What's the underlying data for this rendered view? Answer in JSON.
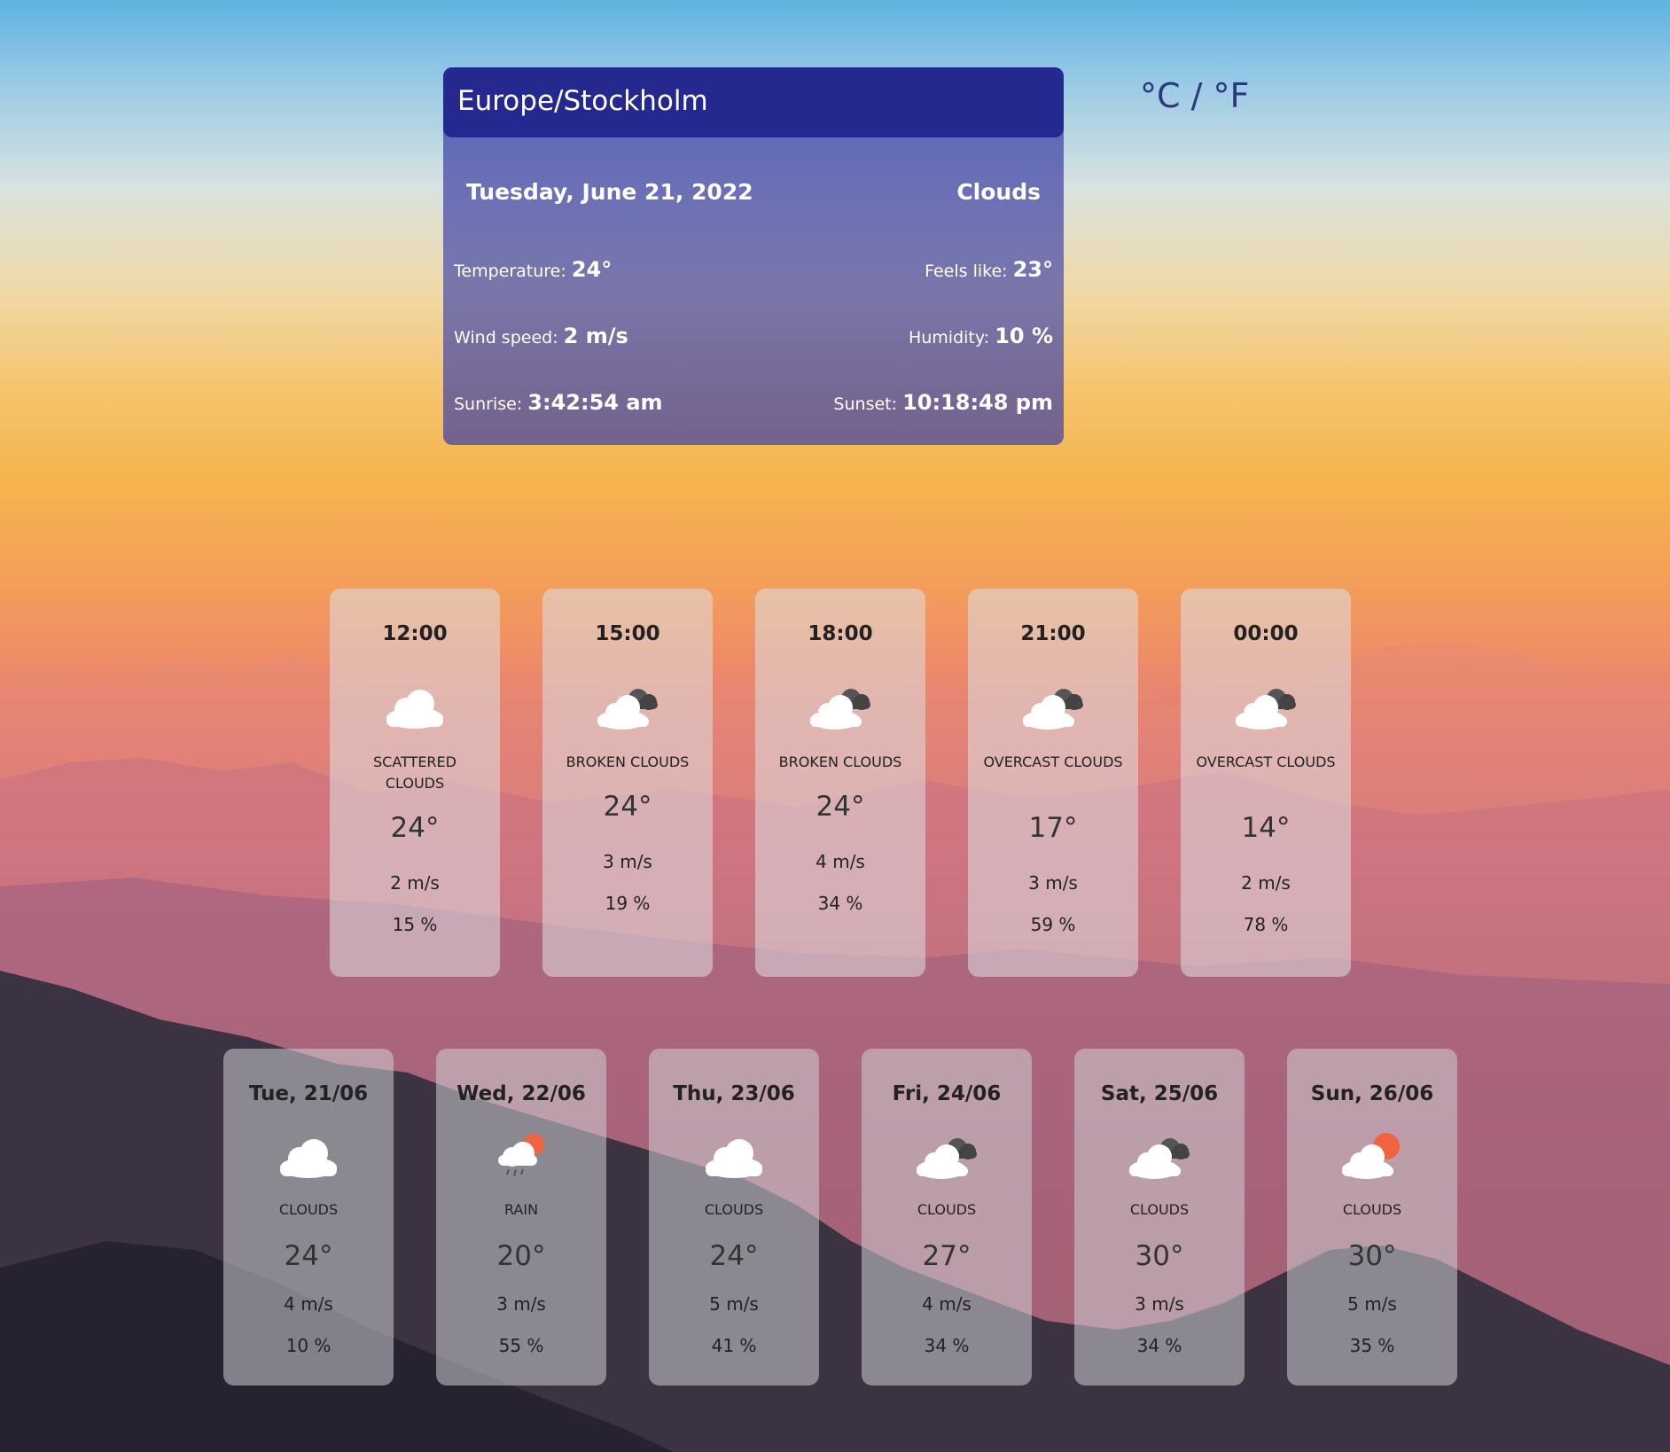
{
  "main": {
    "city": "Europe/Stockholm",
    "date": "Tuesday, June 21, 2022",
    "condition": "Clouds",
    "temperature_label": "Temperature:",
    "temperature_value": "24°",
    "feels_like_label": "Feels like:",
    "feels_like_value": "23°",
    "wind_label": "Wind speed:",
    "wind_value": "2 m/s",
    "humidity_label": "Humidity:",
    "humidity_value": "10 %",
    "sunrise_label": "Sunrise:",
    "sunrise_value": "3:42:54 am",
    "sunset_label": "Sunset:",
    "sunset_value": "10:18:48 pm"
  },
  "unit_toggle": "°C / °F",
  "hourly": [
    {
      "time": "12:00",
      "icon": "cloud-icon",
      "desc": "SCATTERED CLOUDS",
      "temp": "24°",
      "wind": "2 m/s",
      "humidity": "15 %"
    },
    {
      "time": "15:00",
      "icon": "broken-clouds-icon",
      "desc": "BROKEN CLOUDS",
      "temp": "24°",
      "wind": "3 m/s",
      "humidity": "19 %"
    },
    {
      "time": "18:00",
      "icon": "broken-clouds-icon",
      "desc": "BROKEN CLOUDS",
      "temp": "24°",
      "wind": "4 m/s",
      "humidity": "34 %"
    },
    {
      "time": "21:00",
      "icon": "broken-clouds-icon",
      "desc": "OVERCAST CLOUDS",
      "temp": "17°",
      "wind": "3 m/s",
      "humidity": "59 %"
    },
    {
      "time": "00:00",
      "icon": "broken-clouds-icon",
      "desc": "OVERCAST CLOUDS",
      "temp": "14°",
      "wind": "2 m/s",
      "humidity": "78 %"
    }
  ],
  "daily": [
    {
      "day": "Tue, 21/06",
      "icon": "cloud-icon",
      "desc": "CLOUDS",
      "temp": "24°",
      "wind": "4 m/s",
      "humidity": "10 %"
    },
    {
      "day": "Wed, 22/06",
      "icon": "rain-sun-icon",
      "desc": "RAIN",
      "temp": "20°",
      "wind": "3 m/s",
      "humidity": "55 %"
    },
    {
      "day": "Thu, 23/06",
      "icon": "cloud-icon",
      "desc": "CLOUDS",
      "temp": "24°",
      "wind": "5 m/s",
      "humidity": "41 %"
    },
    {
      "day": "Fri, 24/06",
      "icon": "broken-clouds-icon",
      "desc": "CLOUDS",
      "temp": "27°",
      "wind": "4 m/s",
      "humidity": "34 %"
    },
    {
      "day": "Sat, 25/06",
      "icon": "broken-clouds-icon",
      "desc": "CLOUDS",
      "temp": "30°",
      "wind": "3 m/s",
      "humidity": "34 %"
    },
    {
      "day": "Sun, 26/06",
      "icon": "sun-cloud-icon",
      "desc": "CLOUDS",
      "temp": "30°",
      "wind": "5 m/s",
      "humidity": "35 %"
    }
  ]
}
